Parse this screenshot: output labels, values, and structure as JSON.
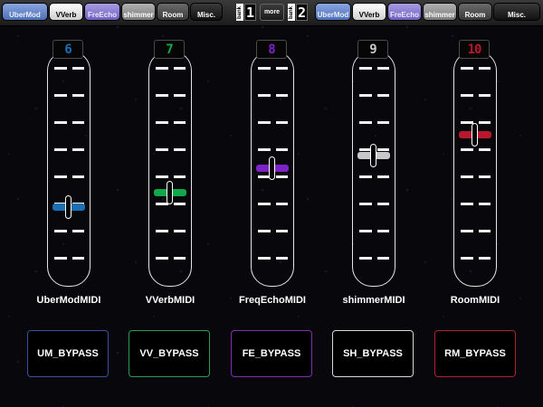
{
  "topbar": {
    "left_tabs": [
      {
        "label": "UberMod",
        "style": "blue"
      },
      {
        "label": "VVerb",
        "style": "white"
      },
      {
        "label": "FreEcho",
        "style": "purple"
      },
      {
        "label": "shimmer",
        "style": "gray"
      },
      {
        "label": "Room",
        "style": "dark"
      },
      {
        "label": "Misc.",
        "style": "black"
      }
    ],
    "bank_label": "bank",
    "bank1_value": "1",
    "more_label": "more",
    "bank2_value": "2",
    "right_tabs": [
      {
        "label": "UberMod",
        "style": "blue"
      },
      {
        "label": "VVerb",
        "style": "white"
      },
      {
        "label": "FreEcho",
        "style": "purple"
      },
      {
        "label": "shimmer",
        "style": "gray"
      },
      {
        "label": "Room",
        "style": "dark"
      },
      {
        "label": "Misc.",
        "style": "black"
      }
    ]
  },
  "faders": [
    {
      "name": "UberModMIDI",
      "channel": "6",
      "color": "#1c6fb3",
      "level": 0.32,
      "bypass_label": "UM_BYPASS",
      "bypass_border": "#3c4f9e"
    },
    {
      "name": "VVerbMIDI",
      "channel": "7",
      "color": "#10a84a",
      "level": 0.39,
      "bypass_label": "VV_BYPASS",
      "bypass_border": "#2c9b55"
    },
    {
      "name": "FreqEchoMIDI",
      "channel": "8",
      "color": "#7e22c8",
      "level": 0.51,
      "bypass_label": "FE_BYPASS",
      "bypass_border": "#7a2fb4"
    },
    {
      "name": "shimmerMIDI",
      "channel": "9",
      "color": "#c8c8c8",
      "level": 0.57,
      "bypass_label": "SH_BYPASS",
      "bypass_border": "#d8d8d8"
    },
    {
      "name": "RoomMIDI",
      "channel": "10",
      "color": "#b8182e",
      "level": 0.67,
      "bypass_label": "RM_BYPASS",
      "bypass_border": "#b0202e"
    }
  ]
}
